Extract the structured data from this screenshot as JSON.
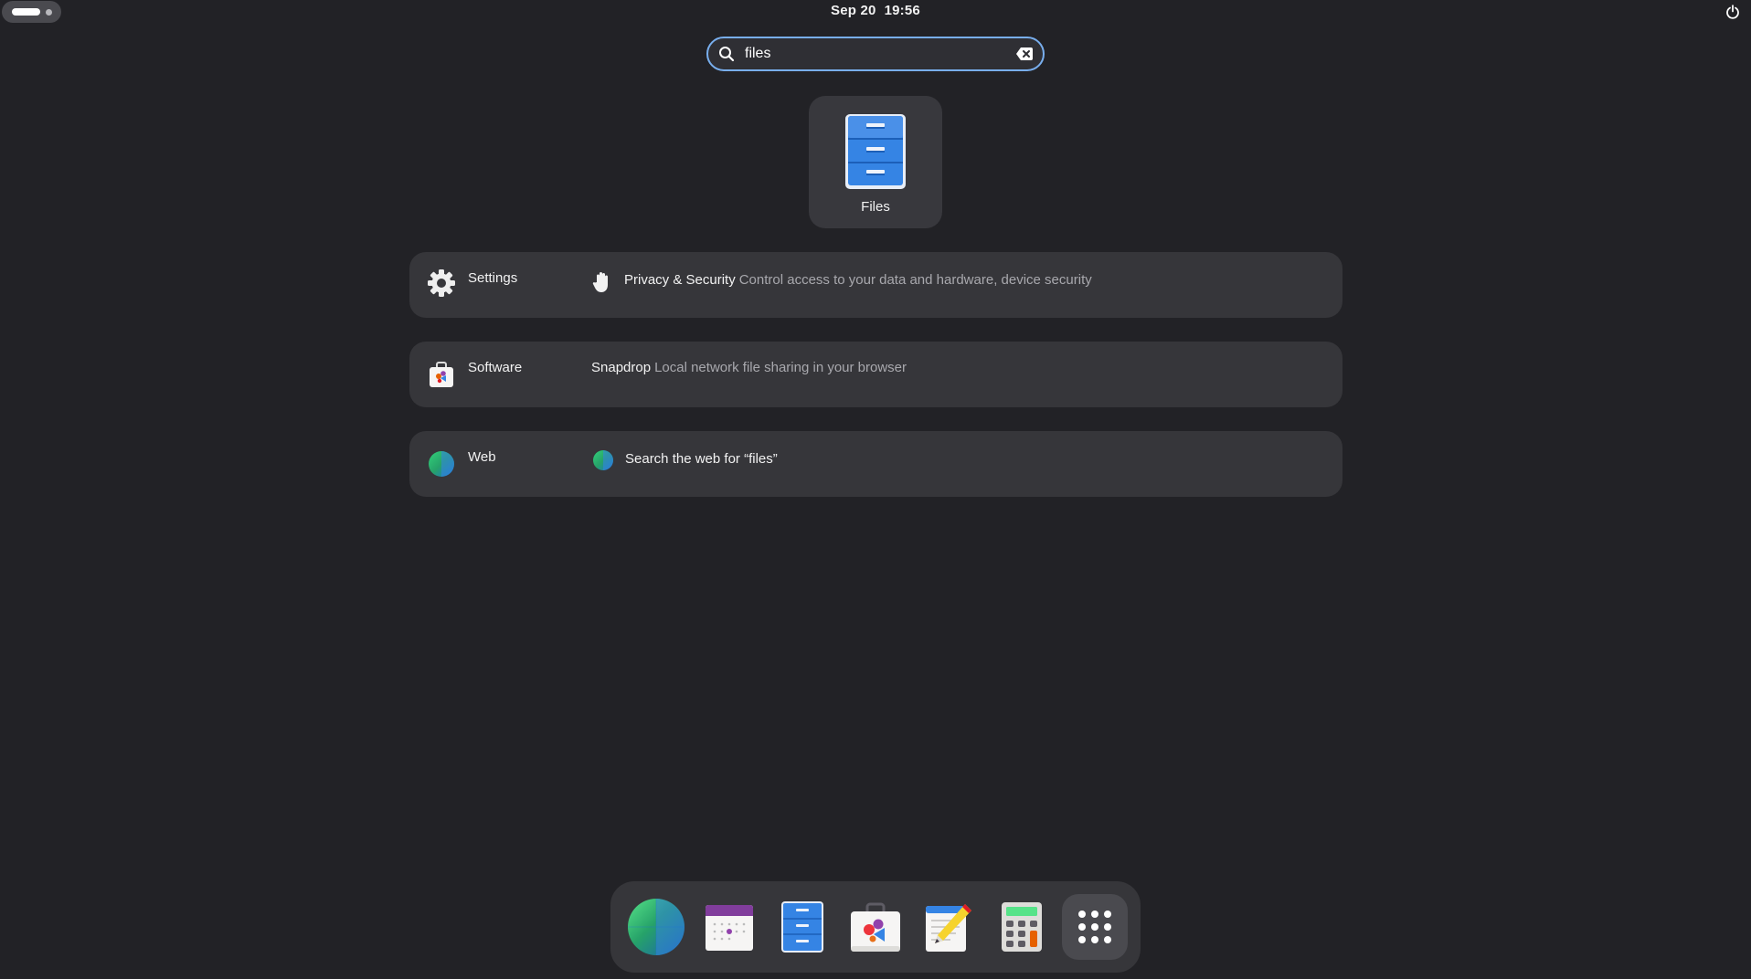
{
  "topbar": {
    "date": "Sep 20",
    "time": "19:56"
  },
  "search": {
    "value": "files"
  },
  "app_result": {
    "name": "Files",
    "icon": "files-cabinet-icon"
  },
  "providers": [
    {
      "name": "Settings",
      "icon": "gear-icon",
      "result_icon": "raised-hand-icon",
      "result_title": "Privacy & Security",
      "result_description": "Control access to your data and hardware, device security"
    },
    {
      "name": "Software",
      "icon": "software-bag-icon",
      "result_title": "Snapdrop",
      "result_description": "Local network file sharing in your browser"
    },
    {
      "name": "Web",
      "icon": "globe-icon",
      "result_icon": "globe-icon",
      "result_title": "Search the web for “files”"
    }
  ],
  "dock": [
    {
      "icon": "web-browser-globe-icon"
    },
    {
      "icon": "calendar-icon"
    },
    {
      "icon": "files-cabinet-icon"
    },
    {
      "icon": "software-bag-icon"
    },
    {
      "icon": "text-editor-icon"
    },
    {
      "icon": "calculator-icon"
    },
    {
      "icon": "show-apps-grid-icon"
    }
  ],
  "colors": {
    "background": "#222226",
    "accent": "#78aeed",
    "row_background": "#36363a"
  }
}
